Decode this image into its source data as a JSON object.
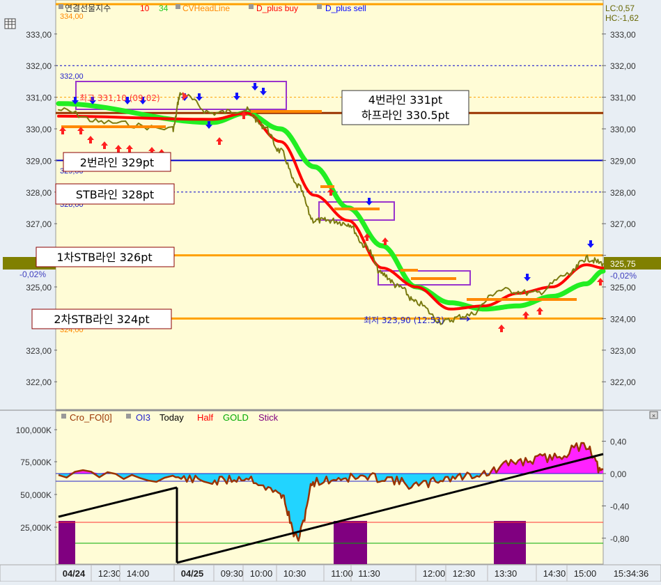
{
  "colors": {
    "panel_bg": "#fffcd6",
    "frame": "#e8eef4",
    "price": "#7a7a10",
    "ma10": "#ff0000",
    "ma34": "#22ee22",
    "head_line": "#ff8800",
    "buy": "#ff2020",
    "sell": "#1010ff",
    "level_orange": "#ffa000",
    "level_brown": "#993300",
    "level_blue": "#0000cc",
    "annotation_border": "#8b0000",
    "box_purple": "#9933cc",
    "osc_line": "#993300",
    "osc_fill": "#22d4ff",
    "osc_pos_fill": "#ff22ff",
    "stick": "#800080",
    "trend": "#000000"
  },
  "main_panel": {
    "legend": [
      "연결선물지수",
      "10",
      "34",
      "CVHeadLine",
      "D_plus buy",
      "D_plus sell"
    ],
    "left_corner_value": "334,00",
    "y_ticks": [
      "333,00",
      "332,00",
      "331,00",
      "330,00",
      "329,00",
      "328,00",
      "327,00",
      "326,00",
      "325,00",
      "324,00",
      "323,00",
      "322,00"
    ],
    "right_info": [
      "LC:0,57",
      "HC:-1,62"
    ],
    "current_price": "325,75",
    "current_change_right": "-0,02%",
    "current_change_left": "-0,02%",
    "level_labels": {
      "l332": "332,00",
      "l329": "329,00",
      "l328": "328,00",
      "l324": "324,00"
    },
    "high_label": "최고 331,10 (09:02)",
    "low_label": "최저 323,90 (12:53)",
    "annotations": [
      "4번라인 331pt",
      "하프라인 330.5pt",
      "2번라인 329pt",
      "STB라인 328pt",
      "1차STB라인 326pt",
      "2차STB라인 324pt"
    ]
  },
  "oscillator_panel": {
    "legend": [
      "Cro_FO[0]",
      "OI3",
      "Today",
      "Half",
      "GOLD",
      "Stick"
    ],
    "left_ticks": [
      "100,000K",
      "75,000K",
      "50,000K",
      "25,000K"
    ],
    "right_ticks": [
      "0,40",
      "0,00",
      "-0,40",
      "-0,80"
    ]
  },
  "time_axis": {
    "labels": [
      "04/24",
      "12:30",
      "14:00",
      "04/25",
      "09:30",
      "10:00",
      "10:30",
      "11:00",
      "11:30",
      "12:00",
      "12:30",
      "13:30",
      "14:30",
      "15:00"
    ],
    "clock": "15:34:36"
  },
  "chart_data": {
    "type": "line",
    "series": [
      {
        "name": "연결선물지수",
        "x": [
          "04/24 12:00",
          "04/24 13:00",
          "04/24 14:30",
          "04/25 09:02",
          "04/25 09:30",
          "04/25 10:00",
          "04/25 10:15",
          "04/25 10:30",
          "04/25 10:45",
          "04/25 11:00",
          "04/25 11:15",
          "04/25 11:30",
          "04/25 11:45",
          "04/25 12:00",
          "04/25 12:15",
          "04/25 12:30",
          "04/25 12:53",
          "04/25 13:15",
          "04/25 13:45",
          "04/25 14:15",
          "04/25 14:45",
          "04/25 15:00",
          "04/25 15:15"
        ],
        "values": [
          330.6,
          330.2,
          330.0,
          331.1,
          330.5,
          330.6,
          330.1,
          329.3,
          328.2,
          327.1,
          327.1,
          327.0,
          326.3,
          325.4,
          325.0,
          324.5,
          323.9,
          324.1,
          324.9,
          324.8,
          325.4,
          325.9,
          325.75
        ]
      },
      {
        "name": "10",
        "x": [
          "04/24 12:00",
          "04/25 09:30",
          "04/25 10:00",
          "04/25 10:30",
          "04/25 11:00",
          "04/25 11:30",
          "04/25 12:00",
          "04/25 12:30",
          "04/25 13:00",
          "04/25 13:30",
          "04/25 14:00",
          "04/25 14:30",
          "04/25 15:00",
          "04/25 15:15"
        ],
        "values": [
          330.4,
          330.3,
          330.5,
          329.6,
          327.9,
          327.1,
          325.6,
          325.0,
          324.3,
          324.4,
          324.8,
          325.0,
          325.7,
          325.6
        ]
      },
      {
        "name": "34",
        "x": [
          "04/24 12:00",
          "04/25 09:30",
          "04/25 10:00",
          "04/25 10:30",
          "04/25 11:00",
          "04/25 11:30",
          "04/25 12:00",
          "04/25 12:30",
          "04/25 13:00",
          "04/25 13:30",
          "04/25 14:00",
          "04/25 14:30",
          "04/25 15:00",
          "04/25 15:15"
        ],
        "values": [
          330.8,
          330.2,
          330.5,
          330.0,
          328.8,
          327.5,
          326.3,
          325.0,
          324.5,
          324.3,
          324.4,
          324.7,
          325.1,
          325.5
        ]
      }
    ],
    "horizontal_levels": [
      331.0,
      330.5,
      329.0,
      328.0,
      326.0,
      324.0,
      332.0,
      334.0
    ],
    "ylim": [
      321.3,
      334.0
    ],
    "oscillator": {
      "name": "Cro_FO[0]",
      "x": [
        "04/24 12:00",
        "04/24 14:30",
        "04/25 09:30",
        "04/25 10:00",
        "04/25 10:30",
        "04/25 10:45",
        "04/25 11:00",
        "04/25 11:30",
        "04/25 12:00",
        "04/25 12:30",
        "04/25 13:00",
        "04/25 13:30",
        "04/25 14:00",
        "04/25 14:30",
        "04/25 15:00",
        "04/25 15:15"
      ],
      "values": [
        0.0,
        -0.05,
        -0.1,
        -0.05,
        -0.25,
        -0.8,
        -0.1,
        -0.05,
        -0.05,
        -0.15,
        -0.05,
        0.0,
        0.15,
        0.2,
        0.35,
        0.0
      ],
      "ylim": [
        -1.1,
        0.55
      ]
    }
  }
}
